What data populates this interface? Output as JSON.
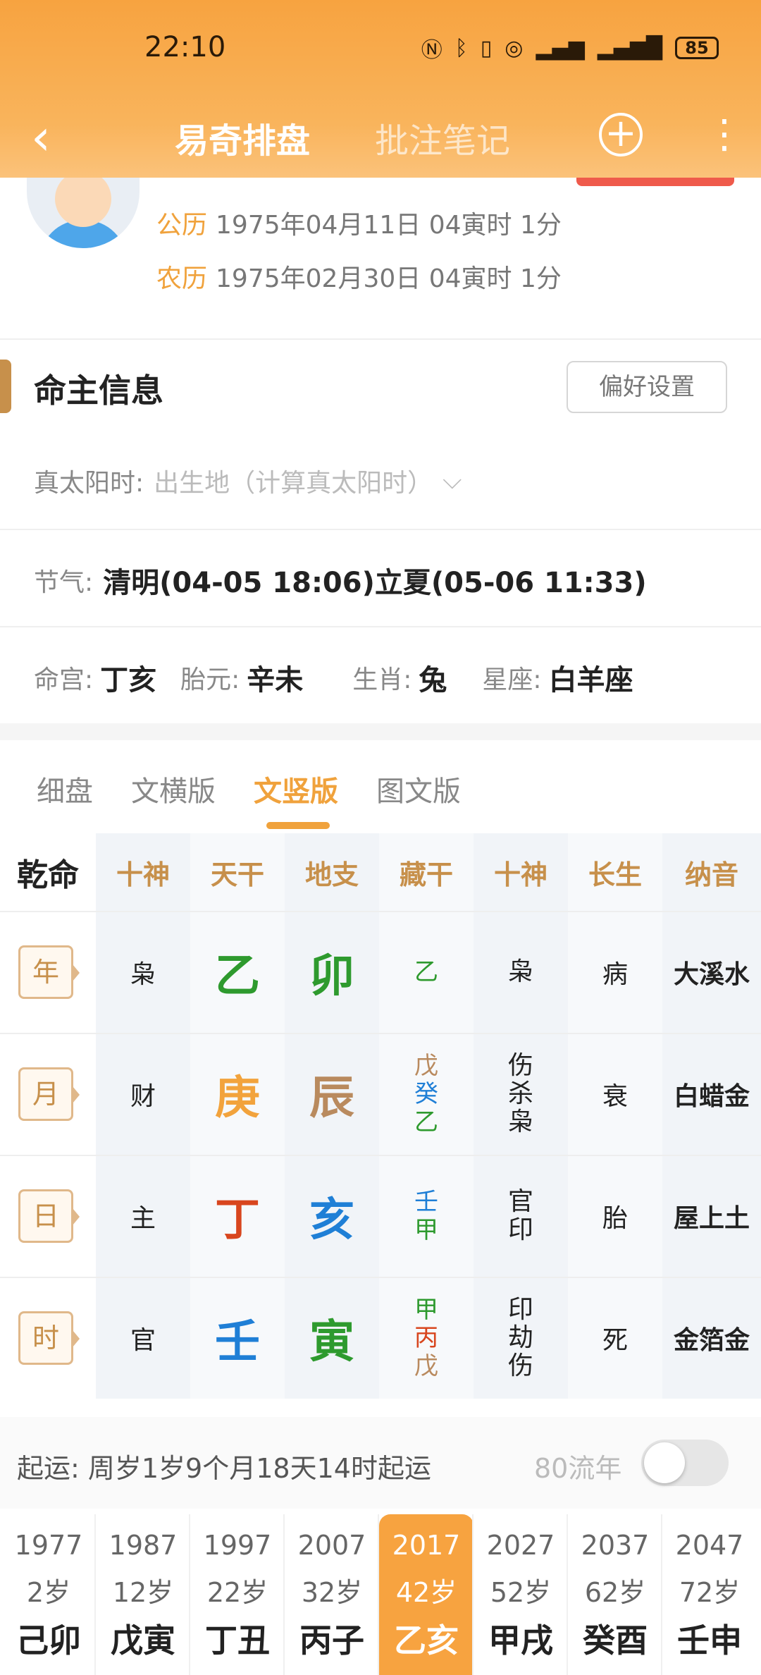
{
  "status": {
    "time": "22:10",
    "battery": "85",
    "icons": [
      "nfc-icon",
      "bluetooth-icon",
      "vibrate-icon",
      "hotspot-icon",
      "signal-4g-icon",
      "signal-5g-icon"
    ]
  },
  "nav": {
    "title": "易奇排盘",
    "subtitle": "批注笔记"
  },
  "profile": {
    "gregorian_label": "公历",
    "gregorian_value": "1975年04月11日 04寅时 1分",
    "lunar_label": "农历",
    "lunar_value": "1975年02月30日 04寅时 1分"
  },
  "info": {
    "title": "命主信息",
    "pref_button": "偏好设置",
    "true_solar_label": "真太阳时:",
    "true_solar_placeholder": "出生地（计算真太阳时）",
    "jieqi_label": "节气:",
    "jieqi_value": "清明(04-05 18:06)立夏(05-06 11:33)",
    "minggong_label": "命宫:",
    "minggong_value": "丁亥",
    "taiyuan_label": "胎元:",
    "taiyuan_value": "辛未",
    "shengxiao_label": "生肖:",
    "shengxiao_value": "兔",
    "xingzuo_label": "星座:",
    "xingzuo_value": "白羊座"
  },
  "tabs": [
    "细盘",
    "文横版",
    "文竖版",
    "图文版"
  ],
  "active_tab": "文竖版",
  "grid": {
    "corner": "乾命",
    "headers": [
      "十神",
      "天干",
      "地支",
      "藏干",
      "十神",
      "长生",
      "纳音"
    ],
    "rows": [
      {
        "label": "年",
        "shishen": "枭",
        "gan": "乙",
        "zhi": "卯",
        "canggan": [
          "乙"
        ],
        "shishen2": [
          "枭"
        ],
        "changsheng": "病",
        "nayin": "大溪水"
      },
      {
        "label": "月",
        "shishen": "财",
        "gan": "庚",
        "zhi": "辰",
        "canggan": [
          "戊",
          "癸",
          "乙"
        ],
        "shishen2": [
          "伤",
          "杀",
          "枭"
        ],
        "changsheng": "衰",
        "nayin": "白蜡金"
      },
      {
        "label": "日",
        "shishen": "主",
        "gan": "丁",
        "zhi": "亥",
        "canggan": [
          "壬",
          "甲"
        ],
        "shishen2": [
          "官",
          "印"
        ],
        "changsheng": "胎",
        "nayin": "屋上土"
      },
      {
        "label": "时",
        "shishen": "官",
        "gan": "壬",
        "zhi": "寅",
        "canggan": [
          "甲",
          "丙",
          "戊"
        ],
        "shishen2": [
          "印",
          "劫",
          "伤"
        ],
        "changsheng": "死",
        "nayin": "金箔金"
      }
    ],
    "colors": {
      "wood": "#2e9a2e",
      "metal": "#f2a33c",
      "fire": "#d8461e",
      "water": "#1f7fd6",
      "earth": "#b98a5e"
    }
  },
  "yun": {
    "text": "起运:  周岁1岁9个月18天14时起运",
    "liunian_label": "80流年"
  },
  "dayun": [
    {
      "year": "1977",
      "age": "2岁",
      "gz": "己卯"
    },
    {
      "year": "1987",
      "age": "12岁",
      "gz": "戊寅"
    },
    {
      "year": "1997",
      "age": "22岁",
      "gz": "丁丑"
    },
    {
      "year": "2007",
      "age": "32岁",
      "gz": "丙子"
    },
    {
      "year": "2017",
      "age": "42岁",
      "gz": "乙亥"
    },
    {
      "year": "2027",
      "age": "52岁",
      "gz": "甲戌"
    },
    {
      "year": "2037",
      "age": "62岁",
      "gz": "癸酉"
    },
    {
      "year": "2047",
      "age": "72岁",
      "gz": "壬申"
    }
  ],
  "active_dayun": "2017"
}
